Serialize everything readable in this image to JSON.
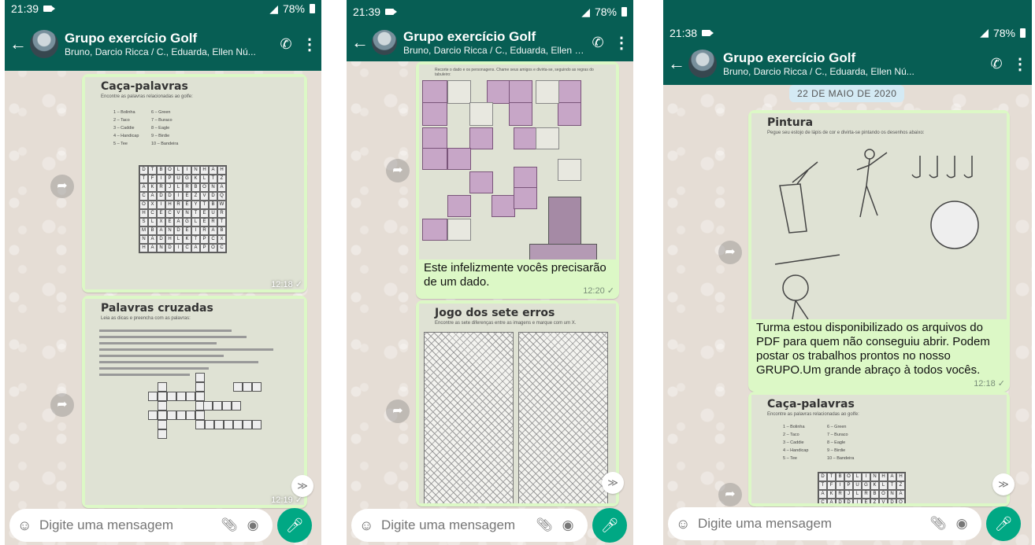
{
  "screen1": {
    "status": {
      "time": "21:39",
      "battery": "78%"
    },
    "header": {
      "title": "Grupo exercício Golf",
      "members": "Bruno, Darcio Ricca / C., Eduarda, Ellen Nú..."
    },
    "messages": [
      {
        "sheet_title": "Caça-palavras",
        "sheet_instructions": "Encontre as palavras relacionadas ao golfe:",
        "time": "12:18 ✓"
      },
      {
        "sheet_title": "Palavras cruzadas",
        "sheet_instructions": "Leia as dicas e preencha com as palavras:",
        "time": "12:19 ✓"
      }
    ],
    "input": {
      "placeholder": "Digite uma mensagem"
    }
  },
  "screen2": {
    "status": {
      "time": "21:39",
      "battery": "78%"
    },
    "header": {
      "title": "Grupo exercício Golf",
      "members": "Bruno, Darcio Ricca / C., Eduarda, Ellen Nú..."
    },
    "messages": [
      {
        "caption": "Este infelizmente vocês precisarão de um dado.",
        "time": "12:20 ✓"
      },
      {
        "sheet_title": "Jogo dos sete erros",
        "sheet_instructions": "Encontre as sete diferenças entre as imagens e marque com um X."
      }
    ],
    "input": {
      "placeholder": "Digite uma mensagem"
    }
  },
  "screen3": {
    "status": {
      "time": "21:38",
      "battery": "78%"
    },
    "header": {
      "title": "Grupo exercício Golf",
      "members": "Bruno, Darcio Ricca / C., Eduarda, Ellen Nú..."
    },
    "date_separator": "22 DE MAIO DE 2020",
    "messages": [
      {
        "sheet_title": "Pintura",
        "sheet_instructions": "Pegue seu estojo de lápis de cor e divirta-se pintando os desenhos abaixo:",
        "caption": "Turma estou disponibilizado os arquivos do PDF para quem não conseguiu abrir. Podem postar os trabalhos prontos no nosso GRUPO.Um grande abraço à todos vocês.",
        "time": "12:18 ✓"
      },
      {
        "sheet_title": "Caça-palavras",
        "sheet_instructions": "Encontre as palavras relacionadas ao golfe:"
      }
    ],
    "input": {
      "placeholder": "Digite uma mensagem"
    }
  },
  "wordsearch": {
    "words_left": [
      "1 – Bolinha",
      "2 – Taco",
      "3 – Caddie",
      "4 – Handicap",
      "5 – Tee"
    ],
    "words_right": [
      "6 – Green",
      "7 – Buraco",
      "8 – Eagle",
      "9 – Birdie",
      "10 – Bandeira"
    ],
    "rows": [
      "DTBOLINHAH",
      "TFIPUGKLTZ",
      "AKRJLRBONA",
      "CADDIEZVDQ",
      "OXIHREYTBW",
      "HCECVNTEUR",
      "SLXEAGLERT",
      "MBANDEIRAB",
      "NADHLKTPCX",
      "HANDICAPOC"
    ]
  },
  "icons": {
    "back": "arrow-left-icon",
    "call": "add-call-icon",
    "menu": "more-vert-icon",
    "forward": "forward-icon",
    "down": "chevron-down-icon",
    "emoji": "emoji-icon",
    "attach": "paperclip-icon",
    "camera": "camera-icon",
    "mic": "microphone-icon"
  },
  "colors": {
    "appbar": "#075e54",
    "bubble": "#dcf8c6",
    "wallpaper": "#e5ddd5",
    "mic": "#00a884"
  }
}
